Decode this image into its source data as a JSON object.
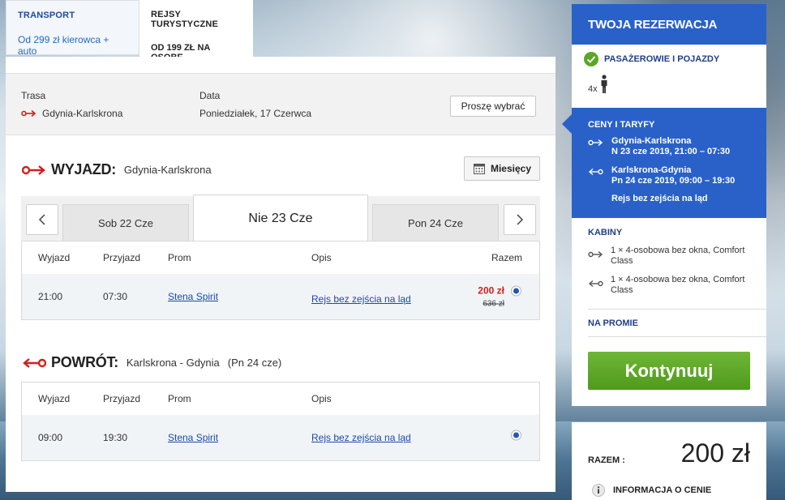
{
  "tabs": {
    "transport": {
      "title": "TRANSPORT",
      "sub": "Od 299 zł kierowca + auto"
    },
    "cruises": {
      "title": "REJSY TURYSTYCZNE",
      "sub": "OD 199 ZŁ NA OSOBĘ"
    }
  },
  "route_bar": {
    "route_label": "Trasa",
    "route_value": "Gdynia-Karlskrona",
    "date_label": "Data",
    "date_value": "Poniedziałek, 17 Czerwca",
    "choose_button": "Proszę wybrać"
  },
  "outbound": {
    "title": "WYJAZD:",
    "route": "Gdynia-Karlskrona",
    "months_button": "Miesięcy",
    "dates": {
      "prev": "Sob 22 Cze",
      "active": "Nie 23 Cze",
      "next": "Pon 24 Cze"
    },
    "columns": {
      "depart": "Wyjazd",
      "arrive": "Przyjazd",
      "ship": "Prom",
      "desc": "Opis",
      "total": "Razem"
    },
    "row": {
      "depart": "21:00",
      "arrive": "07:30",
      "ship": "Stena Spirit",
      "desc": "Rejs bez zejścia na ląd",
      "price": "200 zł",
      "old_price": "636 zł"
    }
  },
  "return": {
    "title": "POWRÓT:",
    "route": "Karlskrona - Gdynia",
    "extra": "(Pn 24 cze)",
    "columns": {
      "depart": "Wyjazd",
      "arrive": "Przyjazd",
      "ship": "Prom",
      "desc": "Opis"
    },
    "row": {
      "depart": "09:00",
      "arrive": "19:30",
      "ship": "Stena Spirit",
      "desc": "Rejs bez zejścia na ląd"
    }
  },
  "sidebar": {
    "title": "TWOJA REZERWACJA",
    "passengers_label": "PASAŻEROWIE I POJAZDY",
    "passenger_count": "4x",
    "prices": {
      "title": "CENY I TARYFY",
      "out_route": "Gdynia-Karlskrona",
      "out_time": "N 23 cze 2019, 21:00 – 07:30",
      "ret_route": "Karlskrona-Gdynia",
      "ret_time": "Pn 24 cze 2019, 09:00 – 19:30",
      "fare": "Rejs bez zejścia na ląd"
    },
    "cabins": {
      "title": "KABINY",
      "out": "1 × 4-osobowa bez okna, Comfort Class",
      "ret": "1 × 4-osobowa bez okna, Comfort Class"
    },
    "onboard_label": "NA PROMIE",
    "continue_button": "Kontynuuj"
  },
  "total": {
    "label": "RAZEM :",
    "value": "200 zł",
    "info": "INFORMACJA O CENIE"
  },
  "colors": {
    "brand_blue": "#2a61c9",
    "accent_red": "#d11f1f",
    "continue_green": "#5aa627"
  }
}
